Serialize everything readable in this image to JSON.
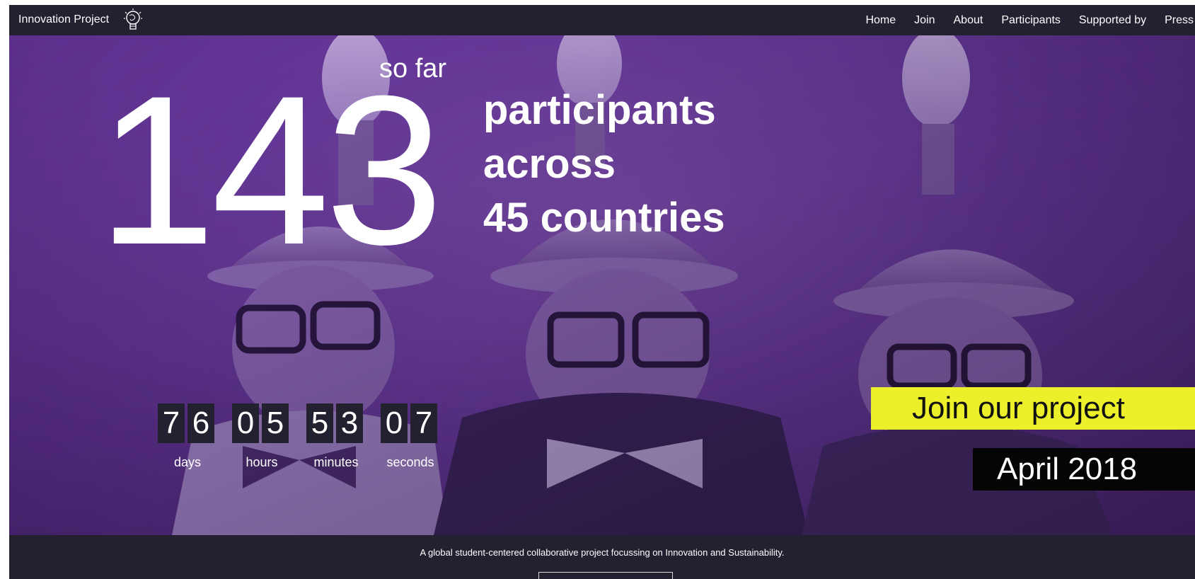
{
  "navbar": {
    "brand": "Innovation Project",
    "logo_icon": "lightbulb-globe-icon",
    "links": [
      "Home",
      "Join",
      "About",
      "Participants",
      "Supported by",
      "Press"
    ]
  },
  "hero": {
    "count": "143",
    "so_far": "so far",
    "lines": [
      "participants",
      "across",
      "45 countries"
    ],
    "countdown": {
      "groups": [
        {
          "digits": [
            "7",
            "6"
          ],
          "label": "days"
        },
        {
          "digits": [
            "0",
            "5"
          ],
          "label": "hours"
        },
        {
          "digits": [
            "5",
            "3"
          ],
          "label": "minutes"
        },
        {
          "digits": [
            "0",
            "7"
          ],
          "label": "seconds"
        }
      ]
    },
    "join_button": "Join our project",
    "date": "April 2018",
    "accent_color": "#ecf02a",
    "overlay_color": "#6a3aa0"
  },
  "footer": {
    "tagline": "A global student-centered collaborative project focussing on Innovation and Sustainability."
  }
}
